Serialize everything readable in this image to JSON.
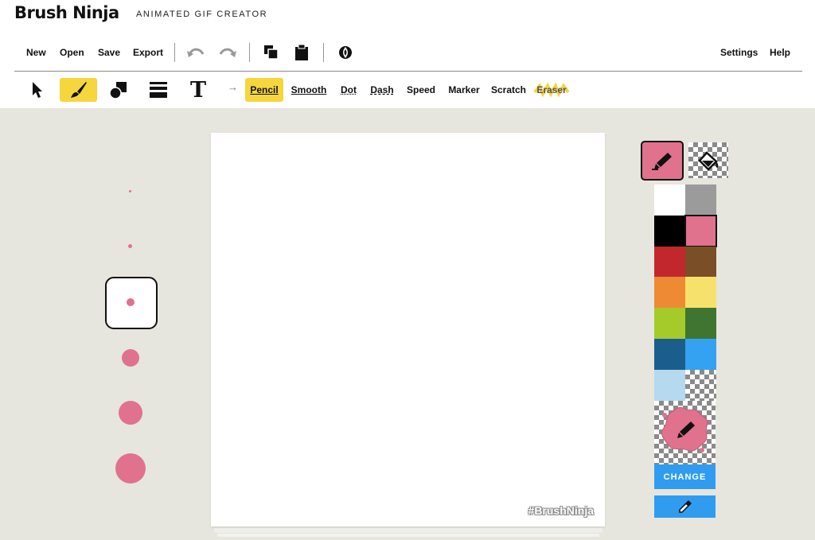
{
  "app": {
    "logo": "Brush Ninja",
    "tagline": "ANIMATED GIF CREATOR"
  },
  "menu": {
    "new": "New",
    "open": "Open",
    "save": "Save",
    "export": "Export",
    "settings": "Settings",
    "help": "Help"
  },
  "strokes": {
    "pencil": "Pencil",
    "smooth": "Smooth",
    "dot": "Dot",
    "dash": "Dash",
    "speed": "Speed",
    "marker": "Marker",
    "scratch": "Scratch",
    "eraser": "Eraser"
  },
  "text_tool_glyph": "T",
  "arrow_glyph": "→",
  "canvas": {
    "watermark": "#BrushNinja"
  },
  "palette": {
    "selected_color": "#e0728e",
    "colors": [
      "#ffffff",
      "#9b9b9b",
      "#000000",
      "#e0728e",
      "#c1272d",
      "#7a4e26",
      "#ee8a34",
      "#f7e16d",
      "#a4cb2a",
      "#3f7530",
      "#1b5e8c",
      "#34a2f0",
      "#b5d9ee",
      "transparent"
    ],
    "change_label": "CHANGE"
  },
  "colors": {
    "accent_yellow": "#f5d63d",
    "accent_blue": "#2f9cf0",
    "brush_pink": "#e0728e"
  },
  "icons": [
    "select-arrow-icon",
    "brush-icon",
    "shapes-icon",
    "line-weight-icon",
    "text-icon",
    "undo-icon",
    "redo-icon",
    "copy-icon",
    "clipboard-icon",
    "onion-skin-icon",
    "pencil-icon",
    "fill-bucket-icon",
    "eyedropper-icon"
  ]
}
